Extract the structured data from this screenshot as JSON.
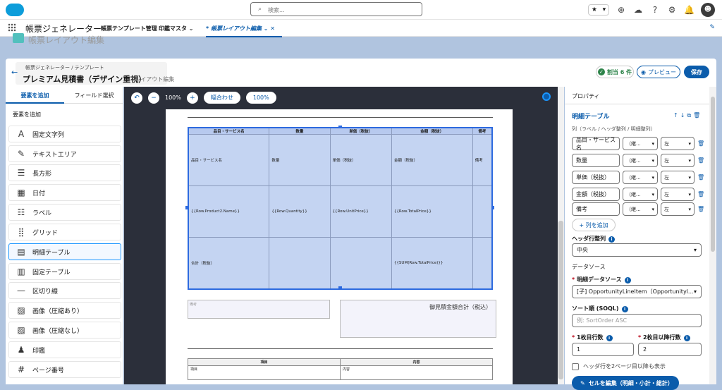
{
  "topbar": {
    "search_placeholder": "検索...",
    "fav_star": "★",
    "fav_caret": "▾",
    "icons": [
      "plus-icon",
      "cloud-icon",
      "help-icon",
      "gear-icon",
      "bell-icon"
    ],
    "icon_glyphs": {
      "plus": "⊕",
      "cloud": "☁",
      "help": "?",
      "gear": "⚙",
      "bell": "🔔"
    }
  },
  "nav": {
    "app_name": "帳票ジェネレーター",
    "tabs": [
      {
        "label": "帳票テンプレート管理"
      },
      {
        "label": "印鑑マスタ",
        "caret": "⌄"
      },
      {
        "label": "* 帳票レイアウト編集",
        "caret": "⌄",
        "close": "✕"
      }
    ]
  },
  "ghost_title": "帳票レイアウト編集",
  "header": {
    "breadcrumb": "帳票ジェネレーター / テンプレート",
    "title": "プレミアム見積書（デザイン重視）",
    "subtitle": "- レイアウト編集",
    "badge_label": "割当 6 件",
    "preview_label": "プレビュー",
    "save_label": "保存"
  },
  "left": {
    "tab_add": "要素を追加",
    "tab_fields": "フィールド選択",
    "section_label": "要素を追加",
    "items": [
      {
        "label": "固定文字列",
        "icon": "A"
      },
      {
        "label": "テキストエリア",
        "icon": "✎"
      },
      {
        "label": "長方形",
        "icon": "☰"
      },
      {
        "label": "日付",
        "icon": "▦"
      },
      {
        "label": "ラベル",
        "icon": "☷"
      },
      {
        "label": "グリッド",
        "icon": "⣿"
      },
      {
        "label": "明細テーブル",
        "icon": "▤"
      },
      {
        "label": "固定テーブル",
        "icon": "▥"
      },
      {
        "label": "区切り線",
        "icon": "—"
      },
      {
        "label": "画像（圧縮あり）",
        "icon": "▨"
      },
      {
        "label": "画像（圧縮なし）",
        "icon": "▨"
      },
      {
        "label": "印鑑",
        "icon": "♟"
      },
      {
        "label": "ページ番号",
        "icon": "#"
      }
    ]
  },
  "canvas": {
    "zoom": "100%",
    "fit_label": "幅合わせ",
    "reset_label": "100%",
    "table": {
      "headers": [
        "品目・サービス名",
        "数量",
        "単価（税抜）",
        "金額（税抜）",
        "備考"
      ],
      "rows": [
        [
          "品目・サービス名",
          "数量",
          "単価（税抜）",
          "金額（税抜）",
          "備考"
        ],
        [
          "{{Row.Product2.Name}}",
          "{{Row.Quantity}}",
          "{{Row.UnitPrice}}",
          "{{Row.TotalPrice}}",
          ""
        ],
        [
          "合計（税抜）",
          "",
          "",
          "{{SUM(Row.TotalPrice)}}",
          ""
        ]
      ]
    },
    "remarks_label": "備考",
    "total_label": "御見積金額合計（税込）",
    "table2": {
      "headers": [
        "項目",
        "内容"
      ],
      "row": [
        "項目",
        "内容"
      ]
    }
  },
  "right": {
    "header": "プロパティ",
    "section_title": "明細テーブル",
    "section_actions": "↑↓⧉🗑",
    "columns_label": "列（ラベル / ヘッダ整列 / 明細整列）",
    "columns": [
      {
        "label": "品目・サービス名",
        "header_align": "（継...",
        "body_align": "左"
      },
      {
        "label": "数量",
        "header_align": "（継...",
        "body_align": "左"
      },
      {
        "label": "単価（税抜）",
        "header_align": "（継...",
        "body_align": "左"
      },
      {
        "label": "金額（税抜）",
        "header_align": "（継...",
        "body_align": "左"
      },
      {
        "label": "備考",
        "header_align": "（継...",
        "body_align": "左"
      }
    ],
    "add_column": "+ 列を追加",
    "header_align_label": "ヘッダ行整列",
    "header_align_value": "中央",
    "datasource_label": "データソース",
    "detail_ds_label": "明細データソース",
    "detail_ds_value": "[子] OpportunityLineItem（Opportunityl...",
    "sort_label": "ソート順 (SOQL)",
    "sort_placeholder": "例: SortOrder ASC",
    "rows1_label": "1枚目行数",
    "rows1_value": "1",
    "rows2_label": "2枚目以降行数",
    "rows2_value": "2",
    "repeat_header_label": "ヘッダ行を2ページ目以降も表示",
    "cell_edit_label": "セルを編集（明細・小計・総計）"
  }
}
